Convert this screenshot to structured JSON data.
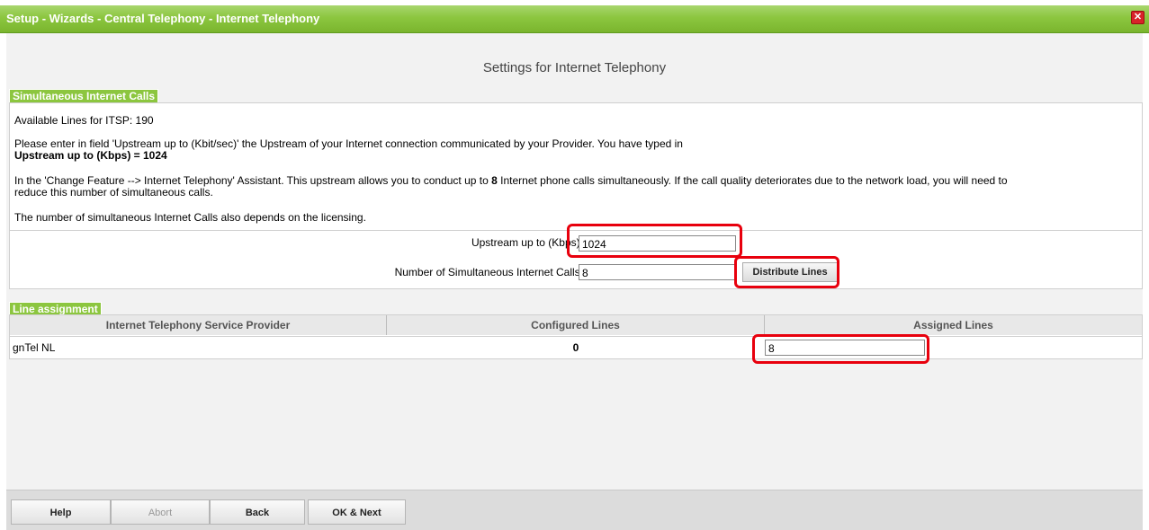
{
  "window": {
    "title": "Setup - Wizards - Central Telephony - Internet Telephony",
    "close_icon": "close-icon"
  },
  "page": {
    "heading": "Settings for Internet Telephony"
  },
  "simultaneous": {
    "section_label": "Simultaneous Internet Calls",
    "available_lines": "Available Lines for ITSP: 190",
    "paragraph1": "Please enter in field 'Upstream up to (Kbit/sec)' the Upstream of your Internet connection communicated by your Provider. You have typed in",
    "paragraph1_bold": "Upstream up to (Kbps) = 1024",
    "paragraph2_a": "In the 'Change Feature --> Internet Telephony' Assistant. This upstream allows you to conduct up to ",
    "paragraph2_bold": "8",
    "paragraph2_b": " Internet phone calls simultaneously. If the call quality deteriorates due to the network load, you will need to",
    "paragraph2_c": "reduce this number of simultaneous calls.",
    "paragraph3": "The number of simultaneous Internet Calls also depends on the licensing.",
    "upstream_label": "Upstream up to (Kbps):",
    "upstream_value": "1024",
    "calls_label": "Number of Simultaneous Internet Calls:",
    "calls_value": "8",
    "distribute_button": "Distribute Lines"
  },
  "line_assignment": {
    "section_label": "Line assignment",
    "columns": [
      "Internet Telephony Service Provider",
      "Configured Lines",
      "Assigned Lines"
    ],
    "rows": [
      {
        "provider": "gnTel NL",
        "configured": "0",
        "assigned": "8"
      }
    ]
  },
  "footer": {
    "help": "Help",
    "abort": "Abort",
    "back": "Back",
    "ok_next": "OK & Next"
  },
  "colors": {
    "accent_green": "#8cc63f",
    "highlight_red": "#e8000d"
  }
}
